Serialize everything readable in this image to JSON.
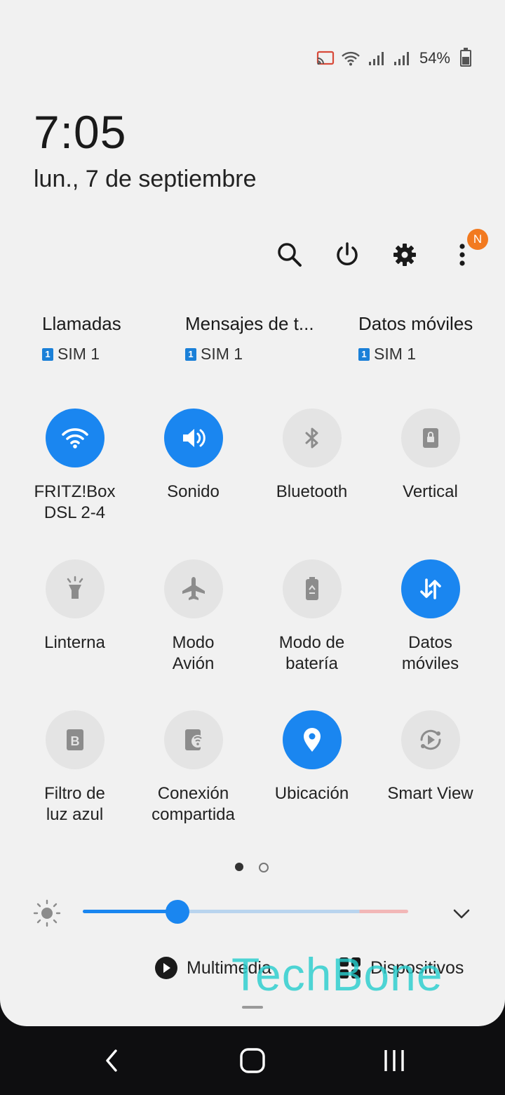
{
  "status_bar": {
    "icons": [
      "cast-icon",
      "wifi-icon",
      "signal-icon",
      "signal-icon",
      "battery-icon"
    ],
    "battery_percent": "54%"
  },
  "header": {
    "time": "7:05",
    "date": "lun., 7 de septiembre"
  },
  "actions": {
    "icons": [
      "search-icon",
      "power-icon",
      "settings-icon",
      "more-icon"
    ],
    "notification_badge": "N",
    "colors": {
      "badge": "#f27a20"
    }
  },
  "sim_cards": [
    {
      "title": "Llamadas",
      "sim": "SIM 1",
      "sim_index": "1"
    },
    {
      "title": "Mensajes de t...",
      "sim": "SIM 1",
      "sim_index": "1"
    },
    {
      "title": "Datos móviles",
      "sim": "SIM 1",
      "sim_index": "1"
    }
  ],
  "tiles": [
    {
      "label": "FRITZ!Box\nDSL 2-4",
      "icon": "wifi-icon",
      "active": true
    },
    {
      "label": "Sonido",
      "icon": "sound-icon",
      "active": true
    },
    {
      "label": "Bluetooth",
      "icon": "bluetooth-icon",
      "active": false
    },
    {
      "label": "Vertical",
      "icon": "rotation-lock-icon",
      "active": false
    },
    {
      "label": "Linterna",
      "icon": "flashlight-icon",
      "active": false
    },
    {
      "label": "Modo\nAvión",
      "icon": "airplane-icon",
      "active": false
    },
    {
      "label": "Modo de\nbatería",
      "icon": "battery-mode-icon",
      "active": false
    },
    {
      "label": "Datos\nmóviles",
      "icon": "mobile-data-icon",
      "active": true
    },
    {
      "label": "Filtro de\nluz azul",
      "icon": "blue-light-icon",
      "active": false
    },
    {
      "label": "Conexión\ncompartida",
      "icon": "hotspot-icon",
      "active": false
    },
    {
      "label": "Ubicación",
      "icon": "location-icon",
      "active": true
    },
    {
      "label": "Smart View",
      "icon": "smart-view-icon",
      "active": false
    }
  ],
  "pager": {
    "pages": 2,
    "current": 1
  },
  "brightness": {
    "value": 0.29,
    "icon": "brightness-icon",
    "expand_icon": "chevron-down-icon"
  },
  "bottom": {
    "media_label": "Multimedia",
    "devices_label": "Dispositivos",
    "watermark": "TechBone"
  },
  "nav": {
    "icons": [
      "back-icon",
      "home-icon",
      "recents-icon"
    ]
  },
  "colors": {
    "accent": "#1a86f0",
    "tile_off": "#e4e4e4",
    "panel": "#f1f1f1"
  }
}
